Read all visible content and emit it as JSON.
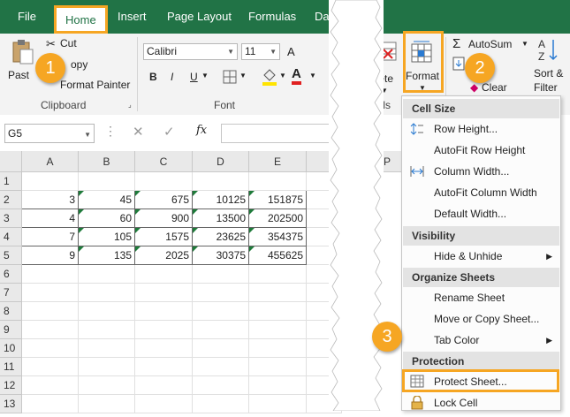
{
  "menu": {
    "file": "File",
    "home": "Home",
    "insert": "Insert",
    "page_layout": "Page Layout",
    "formulas": "Formulas",
    "data_partial": "Da"
  },
  "clipboard": {
    "cut": "Cut",
    "copy_partial": "opy",
    "format_painter": "Format Painter",
    "paste_partial": "Past",
    "group": "Clipboard"
  },
  "font": {
    "name": "Calibri",
    "size": "11",
    "bold": "B",
    "italic": "I",
    "underline": "U",
    "font_color_letter": "A",
    "group": "Font"
  },
  "cells": {
    "delete_partial": "elete",
    "cells_partial": "ells",
    "format": "Format"
  },
  "editing": {
    "autosum": "AutoSum",
    "sort_filter_line1": "Sort &",
    "sort_filter_line2": "Filter",
    "clear_partial": "Clear"
  },
  "namebox": "G5",
  "fx": "fx",
  "columns": [
    "A",
    "B",
    "C",
    "D",
    "E"
  ],
  "extra_col": "P",
  "rows": [
    "1",
    "2",
    "3",
    "4",
    "5",
    "6",
    "7",
    "8",
    "9",
    "10",
    "11",
    "12",
    "13"
  ],
  "table": [
    [
      "3",
      "45",
      "675",
      "10125",
      "151875"
    ],
    [
      "4",
      "60",
      "900",
      "13500",
      "202500"
    ],
    [
      "7",
      "105",
      "1575",
      "23625",
      "354375"
    ],
    [
      "9",
      "135",
      "2025",
      "30375",
      "455625"
    ]
  ],
  "dropdown": {
    "cell_size": "Cell Size",
    "row_height": "Row Height...",
    "autofit_row": "AutoFit Row Height",
    "column_width": "Column Width...",
    "autofit_col": "AutoFit Column Width",
    "default_width": "Default Width...",
    "visibility": "Visibility",
    "hide_unhide": "Hide & Unhide",
    "organize": "Organize Sheets",
    "rename": "Rename Sheet",
    "move_copy": "Move or Copy Sheet...",
    "tab_color": "Tab Color",
    "protection": "Protection",
    "protect_sheet": "Protect Sheet...",
    "lock_cell": "Lock Cell"
  },
  "badges": [
    "1",
    "2",
    "3"
  ],
  "colors": {
    "excel_green": "#217346",
    "highlight": "#F6A623"
  }
}
